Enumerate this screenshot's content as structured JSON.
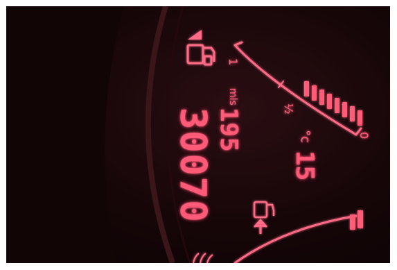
{
  "odometer": {
    "value": "30070"
  },
  "trip": {
    "value": "195",
    "unit": "mls"
  },
  "temperature": {
    "value": "15",
    "unit": "°c"
  },
  "fuel_gauge": {
    "full_label": "1",
    "half_label": "½",
    "empty_label": "0",
    "level": 0.25
  },
  "icons": {
    "fuel_top": "fuel-pump-icon",
    "fuel_door": "fuel-door-arrow-icon",
    "lights": "light-indicator-icon"
  },
  "colors": {
    "lcd": "#ff5b78",
    "background": "#160608"
  }
}
